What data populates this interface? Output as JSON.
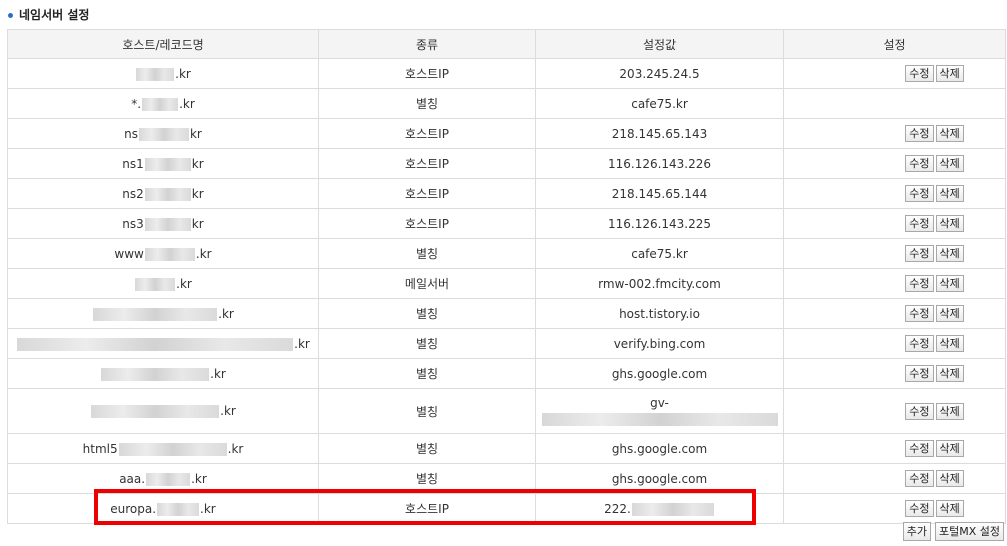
{
  "section": {
    "title": "네임서버 설정"
  },
  "table": {
    "headers": [
      "호스트/레코드명",
      "종류",
      "설정값",
      "설정"
    ],
    "rows": [
      {
        "host_pre": "",
        "host_suf": ".kr",
        "type": "호스트IP",
        "value": "203.245.24.5",
        "value2": "",
        "edit": "수정",
        "del": "삭제"
      },
      {
        "host_pre": "*.",
        "host_suf": ".kr",
        "type": "별칭",
        "value": "cafe75.kr",
        "value2": "",
        "edit": "",
        "del": ""
      },
      {
        "host_pre": "ns",
        "host_suf": "kr",
        "type": "호스트IP",
        "value": "218.145.65.143",
        "value2": "",
        "edit": "수정",
        "del": "삭제"
      },
      {
        "host_pre": "ns1",
        "host_suf": "kr",
        "type": "호스트IP",
        "value": "116.126.143.226",
        "value2": "",
        "edit": "수정",
        "del": "삭제"
      },
      {
        "host_pre": "ns2",
        "host_suf": "kr",
        "type": "호스트IP",
        "value": "218.145.65.144",
        "value2": "",
        "edit": "수정",
        "del": "삭제"
      },
      {
        "host_pre": "ns3",
        "host_suf": "kr",
        "type": "호스트IP",
        "value": "116.126.143.225",
        "value2": "",
        "edit": "수정",
        "del": "삭제"
      },
      {
        "host_pre": "www",
        "host_suf": ".kr",
        "type": "별칭",
        "value": "cafe75.kr",
        "value2": "",
        "edit": "수정",
        "del": "삭제"
      },
      {
        "host_pre": "",
        "host_suf": ".kr",
        "type": "메일서버",
        "value": "rmw-002.fmcity.com",
        "value2": "",
        "edit": "수정",
        "del": "삭제"
      },
      {
        "host_pre": "",
        "host_suf": ".kr",
        "type": "별칭",
        "value": "host.tistory.io",
        "value2": "",
        "edit": "수정",
        "del": "삭제"
      },
      {
        "host_pre": "",
        "host_suf": ".kr",
        "type": "별칭",
        "value": "verify.bing.com",
        "value2": "",
        "edit": "수정",
        "del": "삭제"
      },
      {
        "host_pre": "",
        "host_suf": ".kr",
        "type": "별칭",
        "value": "ghs.google.com",
        "value2": "",
        "edit": "수정",
        "del": "삭제"
      },
      {
        "host_pre": "",
        "host_suf": ".kr",
        "type": "별칭",
        "value": "gv-",
        "value2": "",
        "edit": "수정",
        "del": "삭제"
      },
      {
        "host_pre": "html5",
        "host_suf": ".kr",
        "type": "별칭",
        "value": "ghs.google.com",
        "value2": "",
        "edit": "수정",
        "del": "삭제"
      },
      {
        "host_pre": "aaa.",
        "host_suf": ".kr",
        "type": "별칭",
        "value": "ghs.google.com",
        "value2": "",
        "edit": "수정",
        "del": "삭제"
      },
      {
        "host_pre": "europa.",
        "host_suf": ".kr",
        "type": "호스트IP",
        "value": "222.",
        "value2": "",
        "edit": "수정",
        "del": "삭제"
      }
    ]
  },
  "actions": {
    "add_label": "추가",
    "portal_mx_label": "포털MX 설정"
  },
  "colors": {
    "highlight": "#ee0000",
    "bullet": "#2a6fc9",
    "header_bg": "#f4f4f4",
    "border": "#dcdcdc"
  }
}
